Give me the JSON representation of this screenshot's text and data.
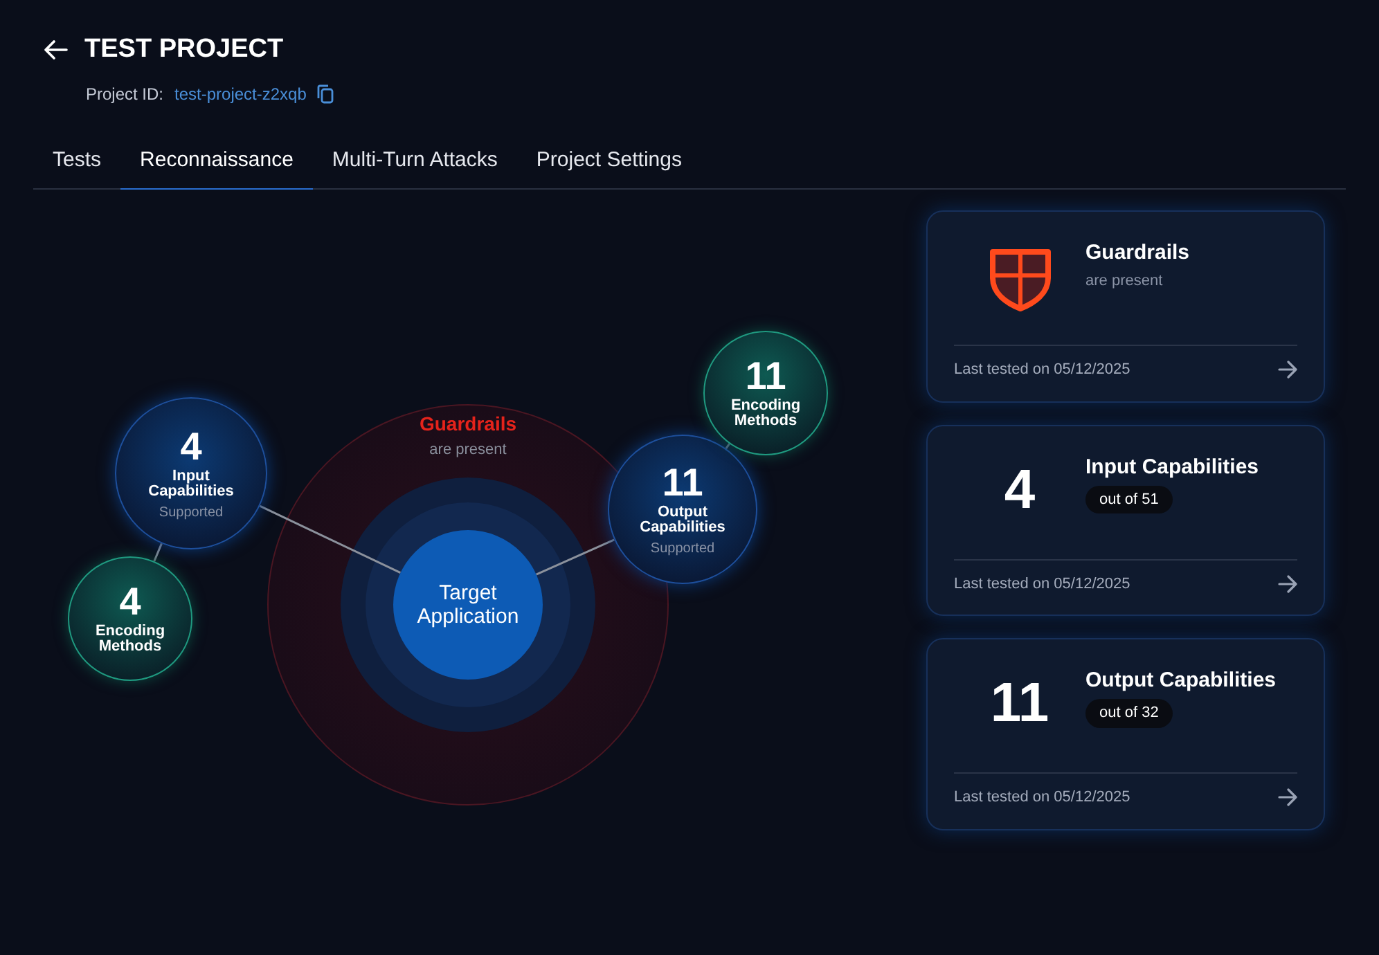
{
  "header": {
    "title": "TEST PROJECT",
    "project_id_label": "Project ID:",
    "project_id": "test-project-z2xqb"
  },
  "tabs": [
    {
      "label": "Tests",
      "selected": false
    },
    {
      "label": "Reconnaissance",
      "selected": true
    },
    {
      "label": "Multi-Turn Attacks",
      "selected": false
    },
    {
      "label": "Project Settings",
      "selected": false
    }
  ],
  "diagram": {
    "guardrail": {
      "title": "Guardrails",
      "subtitle": "are present"
    },
    "target": {
      "label": "Target Application"
    },
    "branches": [
      {
        "capability": {
          "value": "4",
          "label": "Input Capabilities",
          "note": "Supported"
        },
        "encoding": {
          "value": "4",
          "label": "Encoding Methods"
        }
      },
      {
        "capability": {
          "value": "11",
          "label": "Output Capabilities",
          "note": "Supported"
        },
        "encoding": {
          "value": "11",
          "label": "Encoding Methods"
        }
      }
    ]
  },
  "cards": [
    {
      "kind": "guardrail",
      "title": "Guardrails",
      "subtitle": "are present",
      "footer": "Last tested on 05/12/2025"
    },
    {
      "kind": "count",
      "value": "4",
      "title": "Input Capabilities",
      "badge": "out of 51",
      "footer": "Last tested on 05/12/2025"
    },
    {
      "kind": "count",
      "value": "11",
      "title": "Output Capabilities",
      "badge": "out of 32",
      "footer": "Last tested on 05/12/2025"
    }
  ]
}
